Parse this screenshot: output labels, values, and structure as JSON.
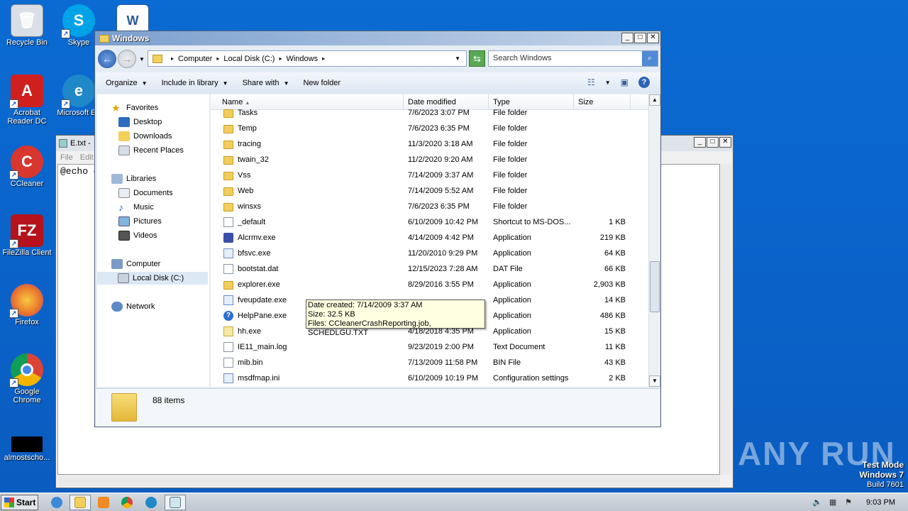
{
  "desktop": {
    "icons": [
      {
        "label": "Recycle Bin",
        "icon": "recycle-bin-icon",
        "color": "#d9dfe6"
      },
      {
        "label": "Skype",
        "icon": "skype-icon",
        "color": "#00a3e8"
      },
      {
        "label": "Acrobat Reader DC",
        "icon": "acrobat-icon",
        "color": "#d01f1f"
      },
      {
        "label": "Microsoft Edge",
        "icon": "edge-icon",
        "color": "#1e88c8"
      },
      {
        "label": "CCleaner",
        "icon": "ccleaner-icon",
        "color": "#d8362e"
      },
      {
        "label": "FileZilla Client",
        "icon": "filezilla-icon",
        "color": "#b5121b"
      },
      {
        "label": "Firefox",
        "icon": "firefox-icon",
        "color": "#e8722b"
      },
      {
        "label": "Google Chrome",
        "icon": "chrome-icon",
        "color": "#2e9e4a"
      },
      {
        "label": "almostscho...",
        "icon": "black-file-icon",
        "color": "#000000"
      }
    ],
    "icon_label_edge": "Microsoft Ed",
    "watermark": "ANY RUN",
    "test_mode": {
      "line1": "Test Mode",
      "line2": "Windows 7",
      "line3": "Build 7601"
    }
  },
  "notepad": {
    "title": "E.txt -",
    "menu": [
      "File",
      "Edit"
    ],
    "content": "@echo o"
  },
  "explorer": {
    "title": "Windows",
    "breadcrumb": [
      "Computer",
      "Local Disk (C:)",
      "Windows"
    ],
    "search_placeholder": "Search Windows",
    "toolbar": {
      "organize": "Organize",
      "include": "Include in library",
      "share": "Share with",
      "new_folder": "New folder"
    },
    "nav": {
      "favorites": "Favorites",
      "desktop": "Desktop",
      "downloads": "Downloads",
      "recent": "Recent Places",
      "libraries": "Libraries",
      "documents": "Documents",
      "music": "Music",
      "pictures": "Pictures",
      "videos": "Videos",
      "computer": "Computer",
      "local_disk": "Local Disk (C:)",
      "network": "Network"
    },
    "columns": {
      "name": "Name",
      "date": "Date modified",
      "type": "Type",
      "size": "Size"
    },
    "files": [
      {
        "name": "Tasks",
        "date": "7/6/2023 3:07 PM",
        "type": "File folder",
        "size": "",
        "kind": "folder"
      },
      {
        "name": "Temp",
        "date": "7/6/2023 6:35 PM",
        "type": "File folder",
        "size": "",
        "kind": "folder"
      },
      {
        "name": "tracing",
        "date": "11/3/2020 3:18 AM",
        "type": "File folder",
        "size": "",
        "kind": "folder"
      },
      {
        "name": "twain_32",
        "date": "11/2/2020 9:20 AM",
        "type": "File folder",
        "size": "",
        "kind": "folder"
      },
      {
        "name": "Vss",
        "date": "7/14/2009 3:37 AM",
        "type": "File folder",
        "size": "",
        "kind": "folder"
      },
      {
        "name": "Web",
        "date": "7/14/2009 5:52 AM",
        "type": "File folder",
        "size": "",
        "kind": "folder"
      },
      {
        "name": "winsxs",
        "date": "7/6/2023 6:35 PM",
        "type": "File folder",
        "size": "",
        "kind": "folder"
      },
      {
        "name": "_default",
        "date": "6/10/2009 10:42 PM",
        "type": "Shortcut to MS-DOS...",
        "size": "1 KB",
        "kind": "short"
      },
      {
        "name": "Alcrmv.exe",
        "date": "4/14/2009 4:42 PM",
        "type": "Application",
        "size": "219 KB",
        "kind": "alc"
      },
      {
        "name": "bfsvc.exe",
        "date": "11/20/2010 9:29 PM",
        "type": "Application",
        "size": "64 KB",
        "kind": "app"
      },
      {
        "name": "bootstat.dat",
        "date": "12/15/2023 7:28 AM",
        "type": "DAT File",
        "size": "66 KB",
        "kind": "file"
      },
      {
        "name": "explorer.exe",
        "date": "8/29/2016 3:55 PM",
        "type": "Application",
        "size": "2,903 KB",
        "kind": "folder"
      },
      {
        "name": "fveupdate.exe",
        "date": "",
        "type": "Application",
        "size": "14 KB",
        "kind": "app"
      },
      {
        "name": "HelpPane.exe",
        "date": "",
        "type": "Application",
        "size": "486 KB",
        "kind": "help"
      },
      {
        "name": "hh.exe",
        "date": "4/18/2018 4:35 PM",
        "type": "Application",
        "size": "15 KB",
        "kind": "hh"
      },
      {
        "name": "IE11_main.log",
        "date": "9/23/2019 2:00 PM",
        "type": "Text Document",
        "size": "11 KB",
        "kind": "file"
      },
      {
        "name": "mib.bin",
        "date": "7/13/2009 11:58 PM",
        "type": "BIN File",
        "size": "43 KB",
        "kind": "file"
      },
      {
        "name": "msdfmap.ini",
        "date": "6/10/2009 10:19 PM",
        "type": "Configuration settings",
        "size": "2 KB",
        "kind": "app"
      }
    ],
    "item_count": "88 items",
    "tooltip": {
      "line1": "Date created: 7/14/2009 3:37 AM",
      "line2": "Size: 32.5 KB",
      "line3": "Files: CCleanerCrashReporting.job, SCHEDLGU.TXT"
    }
  },
  "taskbar": {
    "start": "Start",
    "clock": "9:03 PM"
  }
}
